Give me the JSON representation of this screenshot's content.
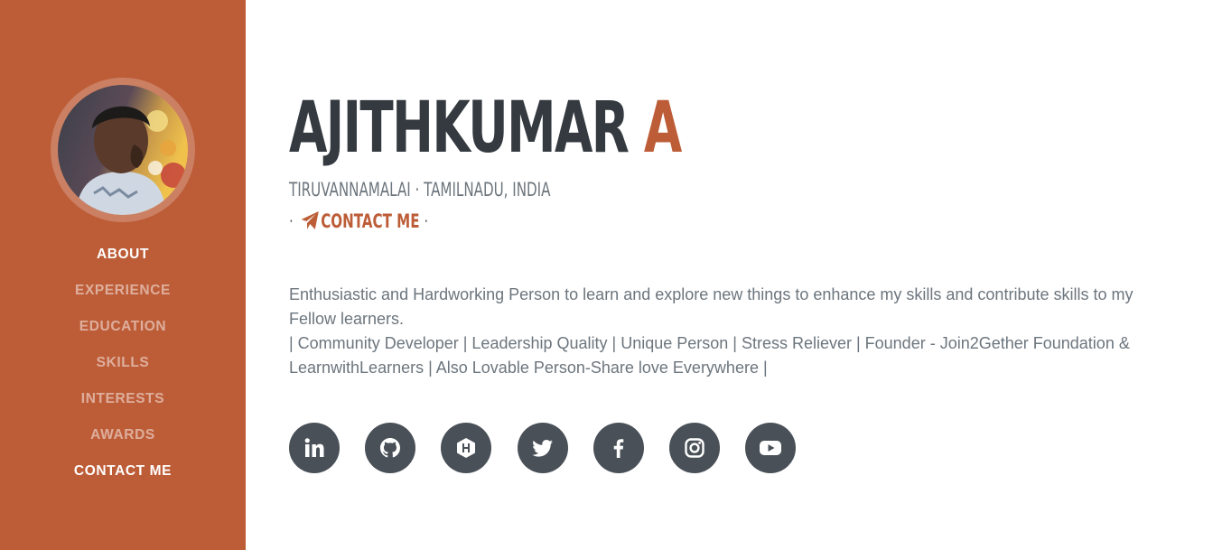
{
  "profile": {
    "first_name": "AJITHKUMAR",
    "last_name": "A",
    "location": "TIRUVANNAMALAI · TAMILNADU, INDIA",
    "contact_prefix": "·",
    "contact_label": "CONTACT ME",
    "contact_suffix": "·",
    "bio_line_1": "Enthusiastic and Hardworking Person to learn and explore new things to enhance my skills and contribute skills to my Fellow learners.",
    "bio_line_2": "| Community Developer | Leadership Quality | Unique Person | Stress Reliever | Founder - Join2Gether Foundation & LearnwithLearners | Also Lovable Person-Share love Everywhere |"
  },
  "nav": {
    "items": [
      {
        "label": "ABOUT",
        "active": true
      },
      {
        "label": "EXPERIENCE",
        "active": false
      },
      {
        "label": "EDUCATION",
        "active": false
      },
      {
        "label": "SKILLS",
        "active": false
      },
      {
        "label": "INTERESTS",
        "active": false
      },
      {
        "label": "AWARDS",
        "active": false
      },
      {
        "label": "CONTACT ME",
        "active": true
      }
    ]
  },
  "social": [
    {
      "icon": "linkedin-icon"
    },
    {
      "icon": "github-icon"
    },
    {
      "icon": "hashnode-icon"
    },
    {
      "icon": "twitter-icon"
    },
    {
      "icon": "facebook-icon"
    },
    {
      "icon": "instagram-icon"
    },
    {
      "icon": "youtube-icon"
    }
  ],
  "colors": {
    "primary": "#bd5d38",
    "dark": "#343a40",
    "muted": "#6c757d",
    "social_bg": "#495057"
  }
}
